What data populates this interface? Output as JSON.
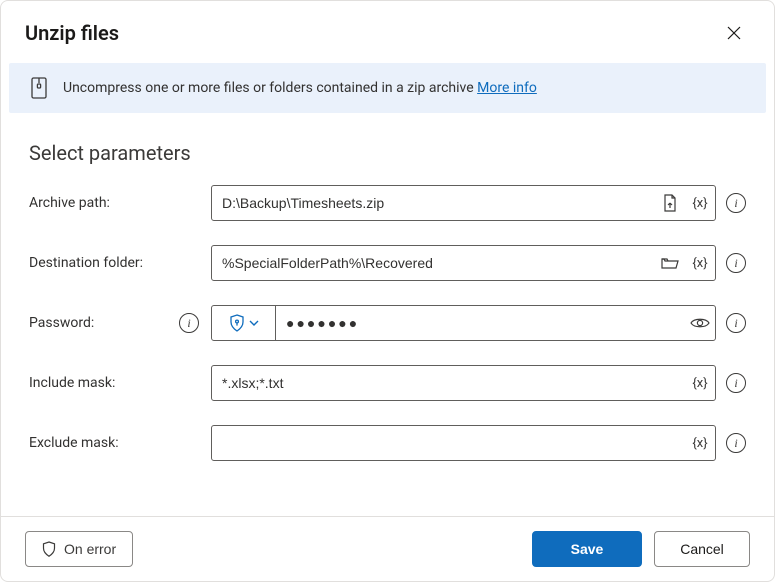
{
  "header": {
    "title": "Unzip files"
  },
  "banner": {
    "text": "Uncompress one or more files or folders contained in a zip archive ",
    "link_label": "More info"
  },
  "section_title": "Select parameters",
  "fields": {
    "archive": {
      "label": "Archive path:",
      "value": "D:\\Backup\\Timesheets.zip",
      "var_token": "{x}"
    },
    "destination": {
      "label": "Destination folder:",
      "value": "%SpecialFolderPath%\\Recovered",
      "var_token": "{x}"
    },
    "password": {
      "label": "Password:",
      "value": "●●●●●●●"
    },
    "include": {
      "label": "Include mask:",
      "value": "*.xlsx;*.txt",
      "var_token": "{x}"
    },
    "exclude": {
      "label": "Exclude mask:",
      "value": "",
      "var_token": "{x}"
    }
  },
  "footer": {
    "on_error": "On error",
    "save": "Save",
    "cancel": "Cancel"
  }
}
